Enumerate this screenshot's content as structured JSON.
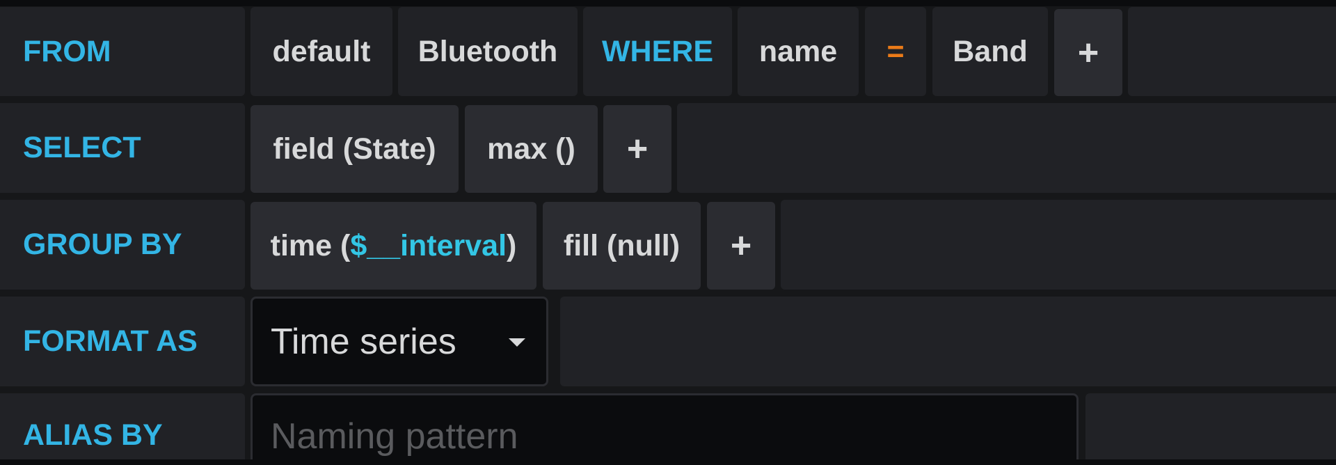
{
  "rows": {
    "from": {
      "label": "FROM",
      "policy": "default",
      "measurement": "Bluetooth",
      "where_keyword": "WHERE",
      "tag_key": "name",
      "operator": "=",
      "tag_value": "Band",
      "add_label": "+"
    },
    "select": {
      "label": "SELECT",
      "field": "field (State)",
      "aggregation": "max ()",
      "add_label": "+"
    },
    "group_by": {
      "label": "GROUP BY",
      "time_prefix": "time (",
      "time_var": "$__interval",
      "time_suffix": ")",
      "fill": "fill (null)",
      "add_label": "+"
    },
    "format_as": {
      "label": "FORMAT AS",
      "selected": "Time series"
    },
    "alias_by": {
      "label": "ALIAS BY",
      "value": "",
      "placeholder": "Naming pattern"
    }
  },
  "colors": {
    "keyword": "#33b5e5",
    "operator": "#eb7b18",
    "variable": "#33c6e5",
    "text": "#d8d9da"
  }
}
